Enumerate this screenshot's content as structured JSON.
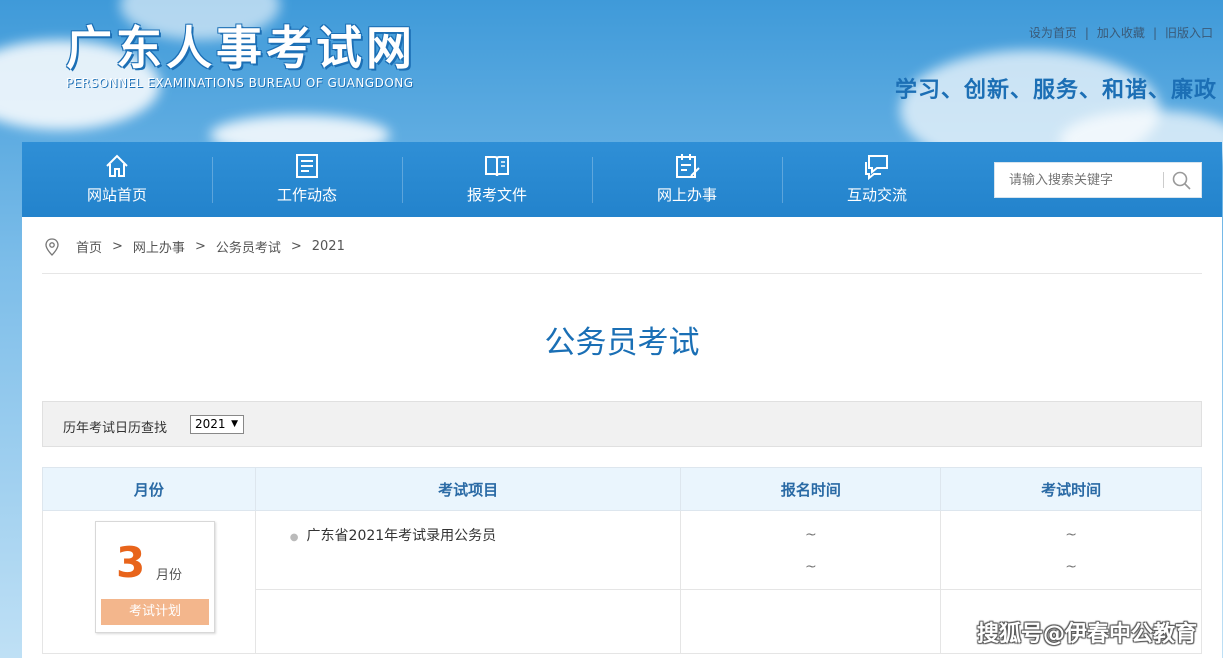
{
  "header": {
    "logo_cn": "广东人事考试网",
    "logo_en": "PERSONNEL EXAMINATIONS BUREAU OF GUANGDONG",
    "top_links": [
      "设为首页",
      "加入收藏",
      "旧版入口"
    ],
    "slogan": "学习、创新、服务、和谐、廉政"
  },
  "nav": {
    "items": [
      {
        "label": "网站首页",
        "icon": "home-icon"
      },
      {
        "label": "工作动态",
        "icon": "news-list-icon"
      },
      {
        "label": "报考文件",
        "icon": "book-icon"
      },
      {
        "label": "网上办事",
        "icon": "clipboard-icon"
      },
      {
        "label": "互动交流",
        "icon": "chat-icon"
      }
    ],
    "search_placeholder": "请输入搜索关键字"
  },
  "breadcrumb": [
    "首页",
    "网上办事",
    "公务员考试",
    "2021"
  ],
  "page_title": "公务员考试",
  "filter": {
    "label": "历年考试日历查找",
    "year": "2021"
  },
  "table": {
    "headers": [
      "月份",
      "考试项目",
      "报名时间",
      "考试时间"
    ],
    "rows": [
      {
        "month": "3",
        "month_unit": "月份",
        "month_tag": "考试计划",
        "item": "广东省2021年考试录用公务员",
        "signup_time": [
          "~",
          "~"
        ],
        "exam_time": [
          "~",
          "~"
        ]
      }
    ]
  },
  "watermark": "搜狐号@伊春中公教育"
}
